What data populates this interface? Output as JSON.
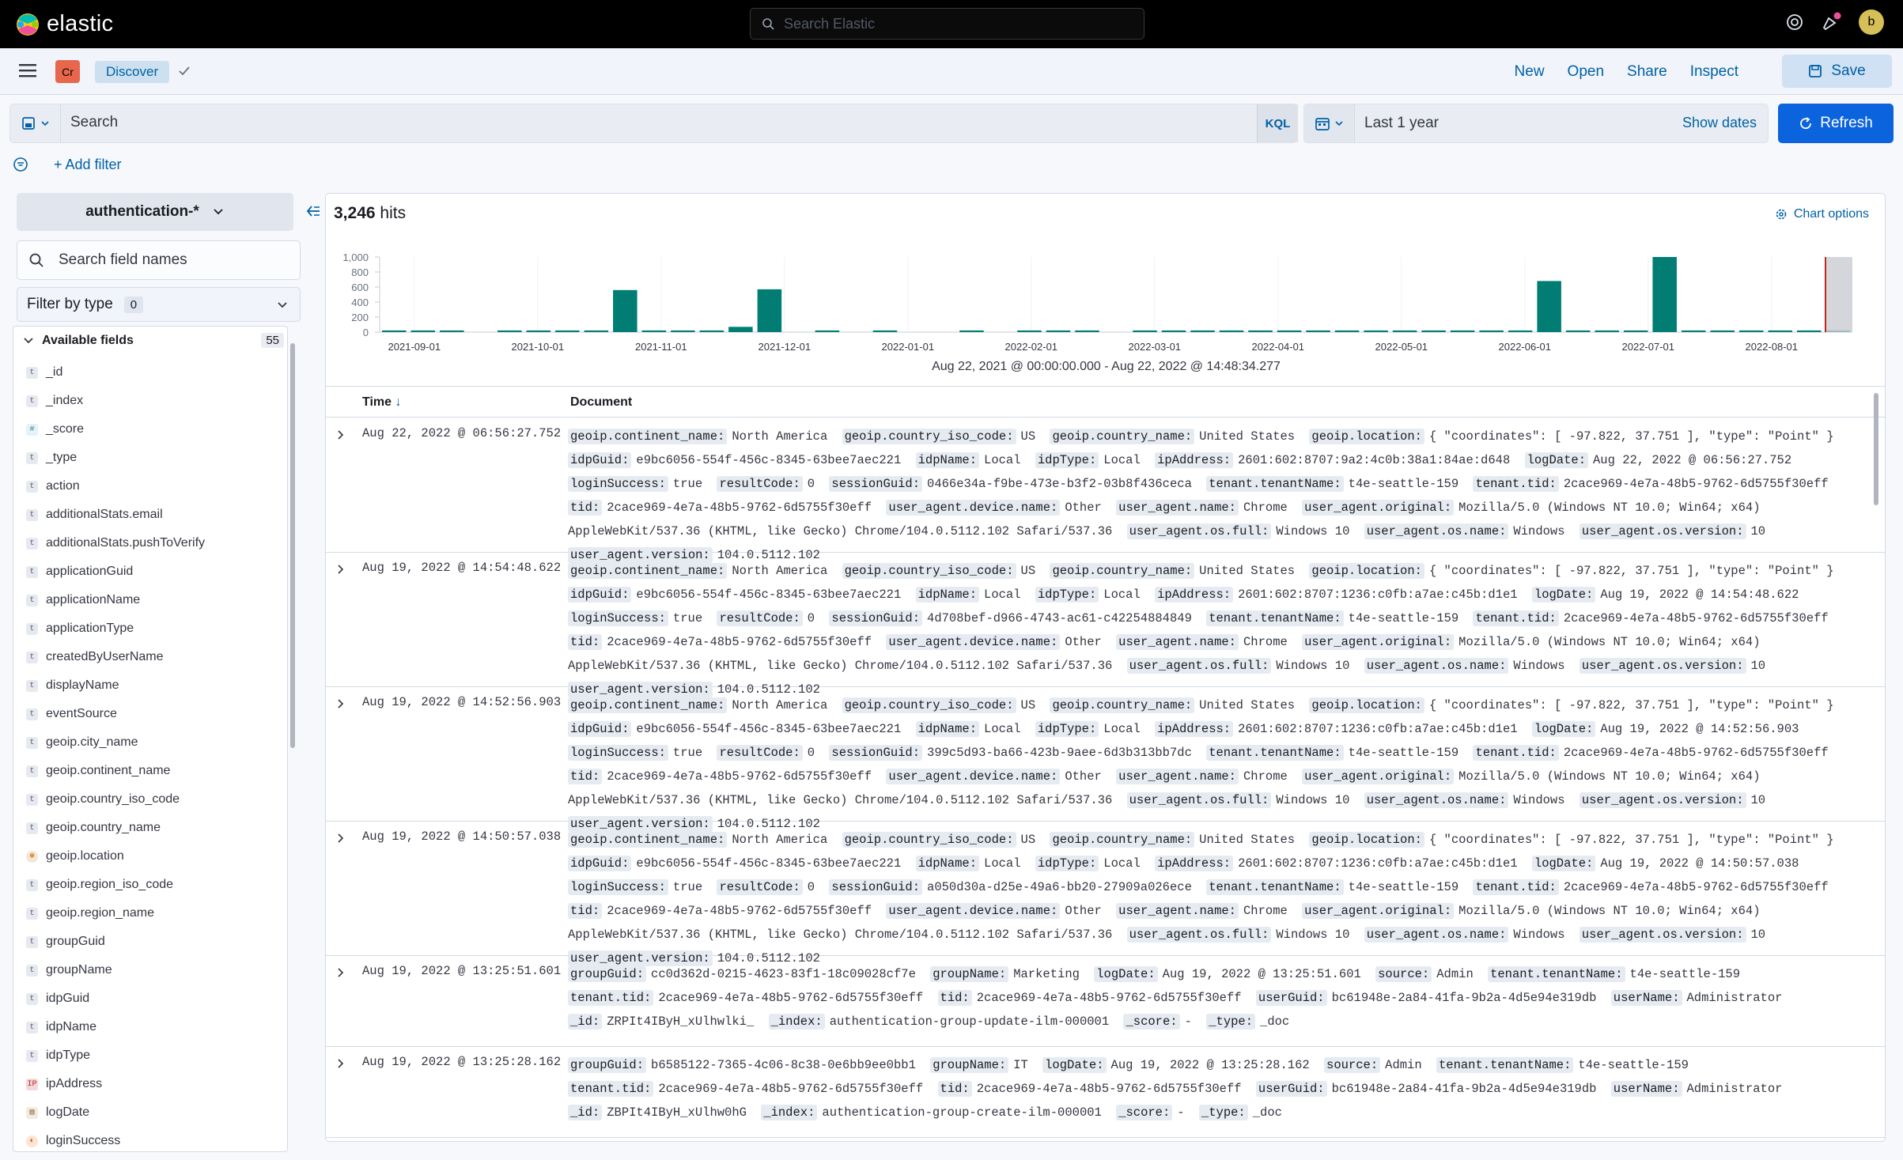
{
  "app": {
    "logo_text": "elastic",
    "search_placeholder": "Search Elastic",
    "user_initial": "b"
  },
  "nav": {
    "space_initials": "Cr",
    "breadcrumb": "Discover",
    "links": [
      "New",
      "Open",
      "Share",
      "Inspect"
    ],
    "save_label": "Save"
  },
  "query": {
    "placeholder": "Search",
    "language": "KQL",
    "date_range_label": "Last 1 year",
    "show_dates": "Show dates",
    "refresh_label": "Refresh",
    "add_filter": "+ Add filter"
  },
  "sidebar": {
    "index_pattern": "authentication-*",
    "search_placeholder": "Search field names",
    "filter_by_type": "Filter by type",
    "filter_count": "0",
    "available_label": "Available fields",
    "available_count": "55",
    "fields": [
      {
        "name": "_id",
        "type": "t"
      },
      {
        "name": "_index",
        "type": "t"
      },
      {
        "name": "_score",
        "type": "#"
      },
      {
        "name": "_type",
        "type": "t"
      },
      {
        "name": "action",
        "type": "t"
      },
      {
        "name": "additionalStats.email",
        "type": "t"
      },
      {
        "name": "additionalStats.pushToVerify",
        "type": "t"
      },
      {
        "name": "applicationGuid",
        "type": "t"
      },
      {
        "name": "applicationName",
        "type": "t"
      },
      {
        "name": "applicationType",
        "type": "t"
      },
      {
        "name": "createdByUserName",
        "type": "t"
      },
      {
        "name": "displayName",
        "type": "t"
      },
      {
        "name": "eventSource",
        "type": "t"
      },
      {
        "name": "geoip.city_name",
        "type": "t"
      },
      {
        "name": "geoip.continent_name",
        "type": "t"
      },
      {
        "name": "geoip.country_iso_code",
        "type": "t"
      },
      {
        "name": "geoip.country_name",
        "type": "t"
      },
      {
        "name": "geoip.location",
        "type": "geo"
      },
      {
        "name": "geoip.region_iso_code",
        "type": "t"
      },
      {
        "name": "geoip.region_name",
        "type": "t"
      },
      {
        "name": "groupGuid",
        "type": "t"
      },
      {
        "name": "groupName",
        "type": "t"
      },
      {
        "name": "idpGuid",
        "type": "t"
      },
      {
        "name": "idpName",
        "type": "t"
      },
      {
        "name": "idpType",
        "type": "t"
      },
      {
        "name": "ipAddress",
        "type": "ip"
      },
      {
        "name": "logDate",
        "type": "date"
      },
      {
        "name": "loginSuccess",
        "type": "bool"
      }
    ]
  },
  "results": {
    "hits_count": "3,246",
    "hits_label": "hits",
    "chart_options": "Chart options",
    "date_range": "Aug 22, 2021 @ 00:00:00.000 - Aug 22, 2022 @ 14:48:34.277",
    "col_time": "Time",
    "col_document": "Document",
    "rows": [
      {
        "time": "Aug 22, 2022 @ 06:56:27.752",
        "fields": [
          [
            "geoip.continent_name:",
            "North America"
          ],
          [
            "geoip.country_iso_code:",
            "US"
          ],
          [
            "geoip.country_name:",
            "United States"
          ],
          [
            "geoip.location:",
            "{ \"coordinates\": [ -97.822, 37.751 ], \"type\": \"Point\" }"
          ],
          [
            "idpGuid:",
            "e9bc6056-554f-456c-8345-63bee7aec221"
          ],
          [
            "idpName:",
            "Local"
          ],
          [
            "idpType:",
            "Local"
          ],
          [
            "ipAddress:",
            "2601:602:8707:9a2:4c0b:38a1:84ae:d648"
          ],
          [
            "logDate:",
            "Aug 22, 2022 @ 06:56:27.752"
          ],
          [
            "loginSuccess:",
            "true"
          ],
          [
            "resultCode:",
            "0"
          ],
          [
            "sessionGuid:",
            "0466e34a-f9be-473e-b3f2-03b8f436ceca"
          ],
          [
            "tenant.tenantName:",
            "t4e-seattle-159"
          ],
          [
            "tenant.tid:",
            "2cace969-4e7a-48b5-9762-6d5755f30eff"
          ],
          [
            "tid:",
            "2cace969-4e7a-48b5-9762-6d5755f30eff"
          ],
          [
            "user_agent.device.name:",
            "Other"
          ],
          [
            "user_agent.name:",
            "Chrome"
          ],
          [
            "user_agent.original:",
            "Mozilla/5.0 (Windows NT 10.0; Win64; x64) AppleWebKit/537.36 (KHTML, like Gecko) Chrome/104.0.5112.102 Safari/537.36"
          ],
          [
            "user_agent.os.full:",
            "Windows 10"
          ],
          [
            "user_agent.os.name:",
            "Windows"
          ],
          [
            "user_agent.os.version:",
            "10"
          ],
          [
            "user_agent.version:",
            "104.0.5112.102"
          ]
        ]
      },
      {
        "time": "Aug 19, 2022 @ 14:54:48.622",
        "fields": [
          [
            "geoip.continent_name:",
            "North America"
          ],
          [
            "geoip.country_iso_code:",
            "US"
          ],
          [
            "geoip.country_name:",
            "United States"
          ],
          [
            "geoip.location:",
            "{ \"coordinates\": [ -97.822, 37.751 ], \"type\": \"Point\" }"
          ],
          [
            "idpGuid:",
            "e9bc6056-554f-456c-8345-63bee7aec221"
          ],
          [
            "idpName:",
            "Local"
          ],
          [
            "idpType:",
            "Local"
          ],
          [
            "ipAddress:",
            "2601:602:8707:1236:c0fb:a7ae:c45b:d1e1"
          ],
          [
            "logDate:",
            "Aug 19, 2022 @ 14:54:48.622"
          ],
          [
            "loginSuccess:",
            "true"
          ],
          [
            "resultCode:",
            "0"
          ],
          [
            "sessionGuid:",
            "4d708bef-d966-4743-ac61-c42254884849"
          ],
          [
            "tenant.tenantName:",
            "t4e-seattle-159"
          ],
          [
            "tenant.tid:",
            "2cace969-4e7a-48b5-9762-6d5755f30eff"
          ],
          [
            "tid:",
            "2cace969-4e7a-48b5-9762-6d5755f30eff"
          ],
          [
            "user_agent.device.name:",
            "Other"
          ],
          [
            "user_agent.name:",
            "Chrome"
          ],
          [
            "user_agent.original:",
            "Mozilla/5.0 (Windows NT 10.0; Win64; x64) AppleWebKit/537.36 (KHTML, like Gecko) Chrome/104.0.5112.102 Safari/537.36"
          ],
          [
            "user_agent.os.full:",
            "Windows 10"
          ],
          [
            "user_agent.os.name:",
            "Windows"
          ],
          [
            "user_agent.os.version:",
            "10"
          ],
          [
            "user_agent.version:",
            "104.0.5112.102"
          ]
        ]
      },
      {
        "time": "Aug 19, 2022 @ 14:52:56.903",
        "fields": [
          [
            "geoip.continent_name:",
            "North America"
          ],
          [
            "geoip.country_iso_code:",
            "US"
          ],
          [
            "geoip.country_name:",
            "United States"
          ],
          [
            "geoip.location:",
            "{ \"coordinates\": [ -97.822, 37.751 ], \"type\": \"Point\" }"
          ],
          [
            "idpGuid:",
            "e9bc6056-554f-456c-8345-63bee7aec221"
          ],
          [
            "idpName:",
            "Local"
          ],
          [
            "idpType:",
            "Local"
          ],
          [
            "ipAddress:",
            "2601:602:8707:1236:c0fb:a7ae:c45b:d1e1"
          ],
          [
            "logDate:",
            "Aug 19, 2022 @ 14:52:56.903"
          ],
          [
            "loginSuccess:",
            "true"
          ],
          [
            "resultCode:",
            "0"
          ],
          [
            "sessionGuid:",
            "399c5d93-ba66-423b-9aee-6d3b313bb7dc"
          ],
          [
            "tenant.tenantName:",
            "t4e-seattle-159"
          ],
          [
            "tenant.tid:",
            "2cace969-4e7a-48b5-9762-6d5755f30eff"
          ],
          [
            "tid:",
            "2cace969-4e7a-48b5-9762-6d5755f30eff"
          ],
          [
            "user_agent.device.name:",
            "Other"
          ],
          [
            "user_agent.name:",
            "Chrome"
          ],
          [
            "user_agent.original:",
            "Mozilla/5.0 (Windows NT 10.0; Win64; x64) AppleWebKit/537.36 (KHTML, like Gecko) Chrome/104.0.5112.102 Safari/537.36"
          ],
          [
            "user_agent.os.full:",
            "Windows 10"
          ],
          [
            "user_agent.os.name:",
            "Windows"
          ],
          [
            "user_agent.os.version:",
            "10"
          ],
          [
            "user_agent.version:",
            "104.0.5112.102"
          ]
        ]
      },
      {
        "time": "Aug 19, 2022 @ 14:50:57.038",
        "fields": [
          [
            "geoip.continent_name:",
            "North America"
          ],
          [
            "geoip.country_iso_code:",
            "US"
          ],
          [
            "geoip.country_name:",
            "United States"
          ],
          [
            "geoip.location:",
            "{ \"coordinates\": [ -97.822, 37.751 ], \"type\": \"Point\" }"
          ],
          [
            "idpGuid:",
            "e9bc6056-554f-456c-8345-63bee7aec221"
          ],
          [
            "idpName:",
            "Local"
          ],
          [
            "idpType:",
            "Local"
          ],
          [
            "ipAddress:",
            "2601:602:8707:1236:c0fb:a7ae:c45b:d1e1"
          ],
          [
            "logDate:",
            "Aug 19, 2022 @ 14:50:57.038"
          ],
          [
            "loginSuccess:",
            "true"
          ],
          [
            "resultCode:",
            "0"
          ],
          [
            "sessionGuid:",
            "a050d30a-d25e-49a6-bb20-27909a026ece"
          ],
          [
            "tenant.tenantName:",
            "t4e-seattle-159"
          ],
          [
            "tenant.tid:",
            "2cace969-4e7a-48b5-9762-6d5755f30eff"
          ],
          [
            "tid:",
            "2cace969-4e7a-48b5-9762-6d5755f30eff"
          ],
          [
            "user_agent.device.name:",
            "Other"
          ],
          [
            "user_agent.name:",
            "Chrome"
          ],
          [
            "user_agent.original:",
            "Mozilla/5.0 (Windows NT 10.0; Win64; x64) AppleWebKit/537.36 (KHTML, like Gecko) Chrome/104.0.5112.102 Safari/537.36"
          ],
          [
            "user_agent.os.full:",
            "Windows 10"
          ],
          [
            "user_agent.os.name:",
            "Windows"
          ],
          [
            "user_agent.os.version:",
            "10"
          ],
          [
            "user_agent.version:",
            "104.0.5112.102"
          ]
        ]
      },
      {
        "time": "Aug 19, 2022 @ 13:25:51.601",
        "fields": [
          [
            "groupGuid:",
            "cc0d362d-0215-4623-83f1-18c09028cf7e"
          ],
          [
            "groupName:",
            "Marketing"
          ],
          [
            "logDate:",
            "Aug 19, 2022 @ 13:25:51.601"
          ],
          [
            "source:",
            "Admin"
          ],
          [
            "tenant.tenantName:",
            "t4e-seattle-159"
          ],
          [
            "tenant.tid:",
            "2cace969-4e7a-48b5-9762-6d5755f30eff"
          ],
          [
            "tid:",
            "2cace969-4e7a-48b5-9762-6d5755f30eff"
          ],
          [
            "userGuid:",
            "bc61948e-2a84-41fa-9b2a-4d5e94e319db"
          ],
          [
            "userName:",
            "Administrator"
          ],
          [
            "_id:",
            "ZRPIt4IByH_xUlhwlki_"
          ],
          [
            "_index:",
            "authentication-group-update-ilm-000001"
          ],
          [
            "_score:",
            "-"
          ],
          [
            "_type:",
            "_doc"
          ]
        ]
      },
      {
        "time": "Aug 19, 2022 @ 13:25:28.162",
        "fields": [
          [
            "groupGuid:",
            "b6585122-7365-4c06-8c38-0e6bb9ee0bb1"
          ],
          [
            "groupName:",
            "IT"
          ],
          [
            "logDate:",
            "Aug 19, 2022 @ 13:25:28.162"
          ],
          [
            "source:",
            "Admin"
          ],
          [
            "tenant.tenantName:",
            "t4e-seattle-159"
          ],
          [
            "tenant.tid:",
            "2cace969-4e7a-48b5-9762-6d5755f30eff"
          ],
          [
            "tid:",
            "2cace969-4e7a-48b5-9762-6d5755f30eff"
          ],
          [
            "userGuid:",
            "bc61948e-2a84-41fa-9b2a-4d5e94e319db"
          ],
          [
            "userName:",
            "Administrator"
          ],
          [
            "_id:",
            "ZBPIt4IByH_xUlhw0hG"
          ],
          [
            "_index:",
            "authentication-group-create-ilm-000001"
          ],
          [
            "_score:",
            "-"
          ],
          [
            "_type:",
            "_doc"
          ]
        ]
      }
    ]
  },
  "chart_data": {
    "type": "bar",
    "ylim": [
      0,
      1000
    ],
    "yticks": [
      "1,000",
      "800",
      "600",
      "400",
      "200",
      "0"
    ],
    "xticks": [
      "2021-09-01",
      "2021-10-01",
      "2021-11-01",
      "2021-12-01",
      "2022-01-01",
      "2022-02-01",
      "2022-03-01",
      "2022-04-01",
      "2022-05-01",
      "2022-06-01",
      "2022-07-01",
      "2022-08-01"
    ],
    "values": [
      22,
      22,
      22,
      0,
      22,
      22,
      22,
      22,
      560,
      22,
      22,
      22,
      70,
      570,
      0,
      22,
      0,
      22,
      0,
      0,
      22,
      0,
      22,
      22,
      22,
      0,
      22,
      22,
      22,
      22,
      22,
      22,
      22,
      22,
      22,
      22,
      22,
      22,
      22,
      22,
      680,
      22,
      22,
      22,
      1000,
      22,
      22,
      22,
      22,
      22,
      22
    ],
    "bar_color": "#017d73"
  }
}
